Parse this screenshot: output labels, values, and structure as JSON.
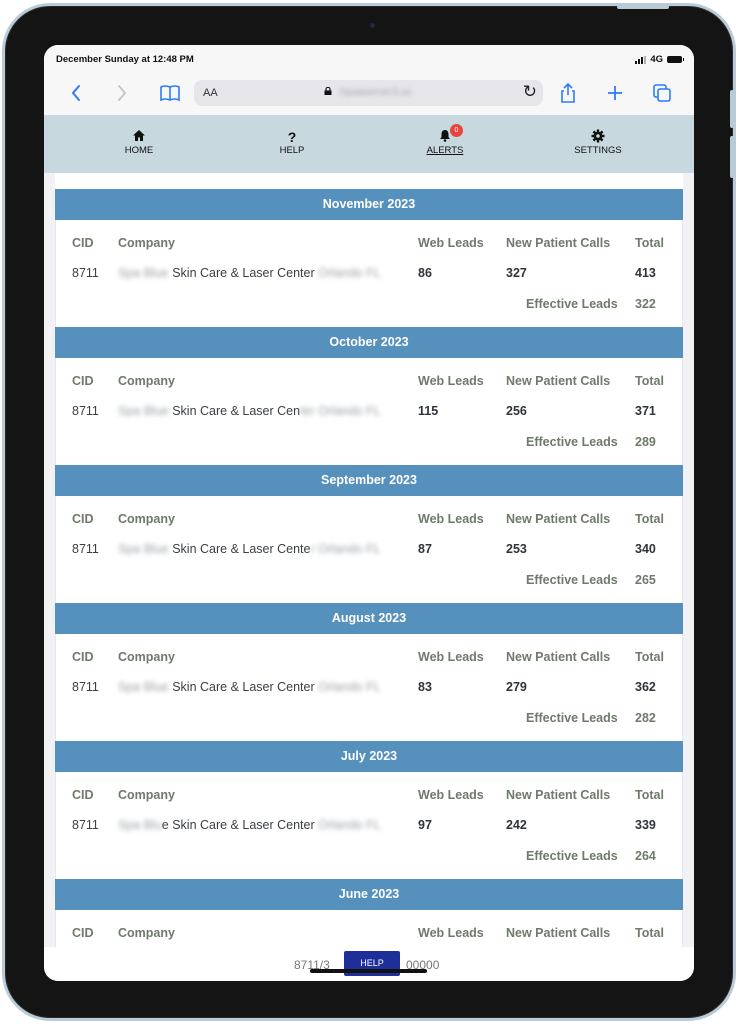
{
  "status_bar": {
    "time": "December Sunday at 12:48 PM",
    "network": "4G"
  },
  "browser": {
    "text_size_label": "AA",
    "url": "hipaaserver3.us",
    "icons": {
      "back": "chevron-left-icon",
      "forward": "chevron-right-icon",
      "bookmarks": "book-icon",
      "lock": "lock-icon",
      "reload": "reload-icon",
      "share": "share-icon",
      "new_tab": "plus-icon",
      "tabs": "tabs-icon"
    }
  },
  "nav": {
    "items": [
      {
        "label": "HOME",
        "icon": "home-icon"
      },
      {
        "label": "HELP",
        "icon": "question-icon"
      },
      {
        "label": "ALERTS",
        "icon": "bell-icon",
        "badge": "0"
      },
      {
        "label": "SETTINGS",
        "icon": "gear-icon"
      }
    ]
  },
  "table_headers": {
    "cid": "CID",
    "company": "Company",
    "web_leads": "Web Leads",
    "new_patient_calls": "New Patient Calls",
    "total": "Total",
    "effective_leads": "Effective Leads"
  },
  "months": [
    {
      "title": "November 2023",
      "cid": "8711",
      "company_prefix": "Spa Blue",
      "company": "Skin Care & Laser Center",
      "company_suffix": "Orlando FL",
      "web_leads": "86",
      "new_patient_calls": "327",
      "total": "413",
      "effective_leads": "322"
    },
    {
      "title": "October 2023",
      "cid": "8711",
      "company_prefix": "Spa Blue",
      "company": "Skin Care & Laser Cen",
      "company_suffix": "ter Orlando FL",
      "web_leads": "115",
      "new_patient_calls": "256",
      "total": "371",
      "effective_leads": "289"
    },
    {
      "title": "September 2023",
      "cid": "8711",
      "company_prefix": "Spa Blue",
      "company": "Skin Care & Laser Cente",
      "company_suffix": "r Orlando FL",
      "web_leads": "87",
      "new_patient_calls": "253",
      "total": "340",
      "effective_leads": "265"
    },
    {
      "title": "August 2023",
      "cid": "8711",
      "company_prefix": "Spa Blue",
      "company": "Skin Care & Laser Center",
      "company_suffix": "Orlando FL",
      "web_leads": "83",
      "new_patient_calls": "279",
      "total": "362",
      "effective_leads": "282"
    },
    {
      "title": "July 2023",
      "cid": "8711",
      "company_prefix": "Spa Blu",
      "company": "e Skin Care & Laser Center",
      "company_suffix": "Orlando FL",
      "web_leads": "97",
      "new_patient_calls": "242",
      "total": "339",
      "effective_leads": "264"
    },
    {
      "title": "June 2023"
    }
  ],
  "footer": {
    "left": "8711/3",
    "help_label": "HELP",
    "right": "00000"
  },
  "colors": {
    "month_header_bg": "#5690bd",
    "nav_bg": "#c7d8df",
    "header_text": "#6e7a6a",
    "help_button": "#1f2f9a",
    "badge": "#e8453c",
    "safari_blue": "#2f7bf5"
  }
}
